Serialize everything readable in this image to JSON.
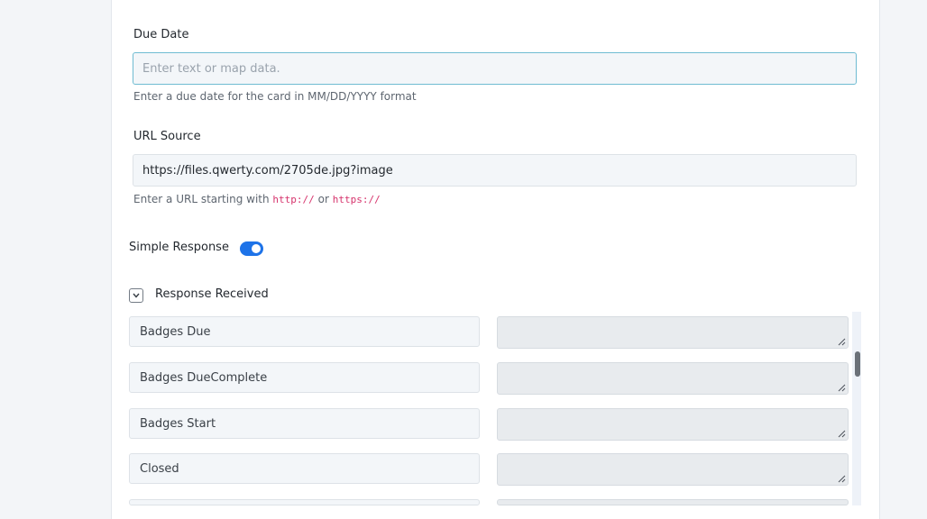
{
  "due_date": {
    "label": "Due Date",
    "placeholder": "Enter text or map data.",
    "hint": "Enter a due date for the card in MM/DD/YYYY format"
  },
  "url_source": {
    "label": "URL Source",
    "value": "https://files.qwerty.com/2705de.jpg?image",
    "hint_prefix": "Enter a URL starting with",
    "hint_code1": "http://",
    "hint_or": "or",
    "hint_code2": "https://"
  },
  "simple_response": {
    "label": "Simple Response",
    "enabled": true
  },
  "response_received": {
    "label": "Response Received",
    "rows": [
      {
        "key": "Badges Due",
        "value": ""
      },
      {
        "key": "Badges DueComplete",
        "value": ""
      },
      {
        "key": "Badges Start",
        "value": ""
      },
      {
        "key": "Closed",
        "value": ""
      },
      {
        "key": "",
        "value": ""
      }
    ]
  },
  "colors": {
    "toggle_on": "#1e73e8",
    "focus_border": "#6fbcd2",
    "code": "#d6336c"
  }
}
